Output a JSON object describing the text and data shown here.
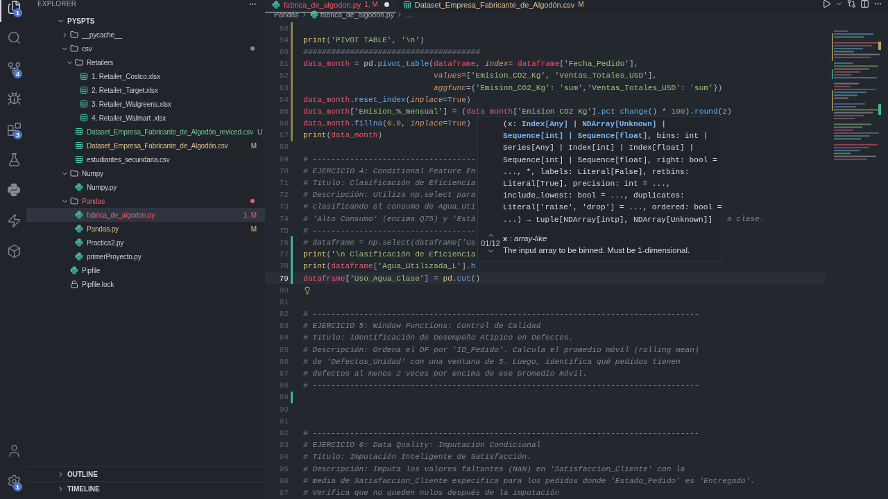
{
  "activity_bar": {
    "items": [
      {
        "kind": "files",
        "badge": "1",
        "selected": true
      },
      {
        "kind": "search",
        "selected": false
      },
      {
        "kind": "source-control",
        "badge": "4",
        "selected": false
      },
      {
        "kind": "debug",
        "selected": false
      },
      {
        "kind": "extensions",
        "badge": "3",
        "selected": false
      },
      {
        "kind": "testing",
        "selected": false
      },
      {
        "kind": "python",
        "selected": false
      },
      {
        "kind": "lightning",
        "selected": false
      },
      {
        "kind": "box",
        "selected": false
      }
    ],
    "bottom": [
      {
        "kind": "account"
      },
      {
        "kind": "settings",
        "badge": "1"
      }
    ]
  },
  "sidebar": {
    "title": "EXPLORER",
    "root": {
      "label": "PYSPTS",
      "expanded": true
    },
    "tree": [
      {
        "name": "__pycache__",
        "kind": "folder",
        "expanded": false,
        "selected": false,
        "dot": false
      },
      {
        "name": "csv",
        "kind": "folder",
        "expanded": true,
        "selected": false,
        "dot": true,
        "children": [
          {
            "name": "Retailers",
            "kind": "folder",
            "expanded": true,
            "selected": false,
            "dot": false,
            "children": [
              {
                "name": "1. Retailer_Costco.xlsx",
                "kind": "sheet",
                "selected": false,
                "dot": false
              },
              {
                "name": "2. Retailer_Target.xlsx",
                "kind": "sheet",
                "selected": false,
                "dot": false
              },
              {
                "name": "3. Retailer_Walgreens.xlsx",
                "kind": "sheet",
                "selected": false,
                "dot": false
              },
              {
                "name": "4. Retailer_Walmart .xlsx",
                "kind": "sheet",
                "selected": false,
                "dot": false
              }
            ]
          },
          {
            "name": "Dataset_Empresa_Fabricante_de_Algodón_reviced.csv",
            "kind": "sheet",
            "color": "#73c991",
            "status": "U",
            "selected": false,
            "dot": false
          },
          {
            "name": "Dataset_Empresa_Fabricante_de_Algodón.csv",
            "kind": "sheet",
            "color": "#e2c08d",
            "status": "M",
            "selected": false,
            "dot": false
          },
          {
            "name": "estudiantes_secundaria.csv",
            "kind": "sheet",
            "selected": false,
            "dot": false
          }
        ]
      },
      {
        "name": "Numpy",
        "kind": "folder",
        "expanded": true,
        "selected": false,
        "dot": false,
        "children": [
          {
            "name": "Numpy.py",
            "kind": "python",
            "selected": false,
            "dot": false
          }
        ]
      },
      {
        "name": "Pandas",
        "kind": "folder",
        "expanded": true,
        "color": "#e8606a",
        "selected": false,
        "dot": true,
        "children": [
          {
            "name": "fabrica_de_algodon.py",
            "kind": "python",
            "color": "#e8606a",
            "status": "1, M",
            "selected": true,
            "dot": false
          },
          {
            "name": "Pandas.py",
            "kind": "python",
            "color": "#e2c08d",
            "status": "M",
            "selected": false,
            "dot": false
          },
          {
            "name": "Practica2.py",
            "kind": "python",
            "selected": false,
            "dot": false
          },
          {
            "name": "primerProyecto.py",
            "kind": "python",
            "selected": false,
            "dot": false
          }
        ]
      },
      {
        "name": "Pipfile",
        "kind": "python",
        "selected": false,
        "dot": false
      },
      {
        "name": "Pipfile.lock",
        "kind": "lock",
        "selected": false,
        "dot": false
      }
    ],
    "sections": [
      {
        "label": "OUTLINE",
        "expanded": false
      },
      {
        "label": "TIMELINE",
        "expanded": false
      }
    ]
  },
  "editor": {
    "tabs": [
      {
        "label": "fabrica_de_algodon.py",
        "kind": "python",
        "status": "1, M",
        "color": "#e8606a",
        "selected": true,
        "dirty": true
      },
      {
        "label": "Dataset_Empresa_Fabricante_de_Algodón.csv",
        "kind": "sheet",
        "status": "M",
        "color": "#e2c08d",
        "selected": false,
        "dirty": false
      }
    ],
    "breadcrumb": [
      {
        "label": "Pandas"
      },
      {
        "label": "fabrica_de_algodon.py",
        "kind": "python"
      },
      {
        "label": "…"
      }
    ],
    "lines": [
      {
        "number": "58",
        "current": false,
        "modified": true
      },
      {
        "number": "59",
        "current": false,
        "modified": true,
        "tokens": [
          {
            "kind": "fn",
            "text": "print"
          },
          {
            "kind": "punct",
            "text": "("
          },
          {
            "kind": "str",
            "text": "'PIVOT TABLE'"
          },
          {
            "kind": "punct",
            "text": ", "
          },
          {
            "kind": "str",
            "text": "'\\n'"
          },
          {
            "kind": "punct",
            "text": ")"
          }
        ]
      },
      {
        "number": "60",
        "current": false,
        "modified": true,
        "tokens": [
          {
            "kind": "comment",
            "text": "######################################"
          }
        ]
      },
      {
        "number": "61",
        "current": false,
        "modified": true,
        "tokens": [
          {
            "kind": "var",
            "text": "data_month"
          },
          {
            "kind": "punct",
            "text": " = "
          },
          {
            "kind": "mod",
            "text": "pd"
          },
          {
            "kind": "punct",
            "text": "."
          },
          {
            "kind": "method",
            "text": "pivot_table"
          },
          {
            "kind": "punct",
            "text": "("
          },
          {
            "kind": "var",
            "text": "dataframe"
          },
          {
            "kind": "punct",
            "text": ", "
          },
          {
            "kind": "param",
            "text": "index"
          },
          {
            "kind": "punct",
            "text": "= "
          },
          {
            "kind": "var",
            "text": "dataframe"
          },
          {
            "kind": "punct",
            "text": "["
          },
          {
            "kind": "str",
            "text": "'Fecha_Pedido'"
          },
          {
            "kind": "punct",
            "text": "],"
          }
        ]
      },
      {
        "number": "62",
        "current": false,
        "modified": true,
        "tokens": [
          {
            "kind": "param",
            "text": "                            values"
          },
          {
            "kind": "punct",
            "text": "=["
          },
          {
            "kind": "str",
            "text": "'Emision_CO2_Kg'"
          },
          {
            "kind": "punct",
            "text": ", "
          },
          {
            "kind": "str",
            "text": "'Ventas_Totales_USD'"
          },
          {
            "kind": "punct",
            "text": "],"
          }
        ]
      },
      {
        "number": "63",
        "current": false,
        "modified": true,
        "tokens": [
          {
            "kind": "param",
            "text": "                            aggfunc"
          },
          {
            "kind": "punct",
            "text": "={"
          },
          {
            "kind": "str",
            "text": "'Emision_CO2_Kg'"
          },
          {
            "kind": "punct",
            "text": ": "
          },
          {
            "kind": "str",
            "text": "'sum'"
          },
          {
            "kind": "punct",
            "text": ","
          },
          {
            "kind": "str",
            "text": "'Ventas_Totales_USD'"
          },
          {
            "kind": "punct",
            "text": ": "
          },
          {
            "kind": "str",
            "text": "'sum'"
          },
          {
            "kind": "punct",
            "text": "})"
          }
        ]
      },
      {
        "number": "64",
        "current": false,
        "modified": true,
        "tokens": [
          {
            "kind": "var",
            "text": "data_month"
          },
          {
            "kind": "punct",
            "text": "."
          },
          {
            "kind": "method",
            "text": "reset_index"
          },
          {
            "kind": "punct",
            "text": "("
          },
          {
            "kind": "param",
            "text": "inplace"
          },
          {
            "kind": "punct",
            "text": "="
          },
          {
            "kind": "const",
            "text": "True"
          },
          {
            "kind": "punct",
            "text": ")"
          }
        ]
      },
      {
        "number": "65",
        "current": false,
        "modified": true,
        "tokens": [
          {
            "kind": "var",
            "text": "data_month"
          },
          {
            "kind": "punct",
            "text": "["
          },
          {
            "kind": "str",
            "text": "'Emision_%_mensual'"
          },
          {
            "kind": "punct",
            "text": "] = ("
          },
          {
            "kind": "var",
            "text": "data month"
          },
          {
            "kind": "punct",
            "text": "["
          },
          {
            "kind": "str",
            "text": "'Emision CO2 Kg'"
          },
          {
            "kind": "punct",
            "text": "]."
          },
          {
            "kind": "method",
            "text": "pct change"
          },
          {
            "kind": "punct",
            "text": "() * "
          },
          {
            "kind": "num",
            "text": "100"
          },
          {
            "kind": "punct",
            "text": ")."
          },
          {
            "kind": "method",
            "text": "round"
          },
          {
            "kind": "punct",
            "text": "("
          },
          {
            "kind": "num",
            "text": "2"
          },
          {
            "kind": "punct",
            "text": ")"
          }
        ]
      },
      {
        "number": "66",
        "current": false,
        "modified": true,
        "tokens": [
          {
            "kind": "var",
            "text": "data_month"
          },
          {
            "kind": "punct",
            "text": "."
          },
          {
            "kind": "method",
            "text": "fillna"
          },
          {
            "kind": "punct",
            "text": "("
          },
          {
            "kind": "num",
            "text": "0.0"
          },
          {
            "kind": "punct",
            "text": ", "
          },
          {
            "kind": "param",
            "text": "inplace"
          },
          {
            "kind": "punct",
            "text": "="
          },
          {
            "kind": "const",
            "text": "True"
          },
          {
            "kind": "punct",
            "text": ")"
          }
        ]
      },
      {
        "number": "67",
        "current": false,
        "modified": true,
        "tokens": [
          {
            "kind": "fn",
            "text": "print"
          },
          {
            "kind": "punct",
            "text": "("
          },
          {
            "kind": "var",
            "text": "data_month"
          },
          {
            "kind": "punct",
            "text": ")"
          }
        ]
      },
      {
        "number": "68",
        "current": false
      },
      {
        "number": "69",
        "current": false,
        "tokens": [
          {
            "kind": "comment",
            "text": "# -----------------------------------"
          }
        ]
      },
      {
        "number": "70",
        "current": false,
        "tokens": [
          {
            "kind": "comment",
            "text": "# EJERCICIO 4: Conditional Feature En"
          }
        ]
      },
      {
        "number": "71",
        "current": false,
        "tokens": [
          {
            "kind": "comment",
            "text": "# Título: Clasificación de Eficiencia"
          }
        ]
      },
      {
        "number": "72",
        "current": false,
        "tokens": [
          {
            "kind": "comment",
            "text": "# Descripción: Utiliza np.select para"
          }
        ]
      },
      {
        "number": "73",
        "current": false,
        "tokens": [
          {
            "kind": "comment",
            "text": "# clasificando el consumo de Agua_Uti"
          }
        ]
      },
      {
        "number": "74",
        "current": false,
        "tokens": [
          {
            "kind": "comment",
            "text": "# 'Alto Consumo' (encima Q75) y 'Está"
          },
          {
            "kind": "tail",
            "text": "a clase."
          }
        ]
      },
      {
        "number": "75",
        "current": false,
        "tokens": [
          {
            "kind": "comment",
            "text": "# -----------------------------------"
          }
        ]
      },
      {
        "number": "76",
        "current": false,
        "added": true,
        "tokens": [
          {
            "kind": "comment",
            "text": "# dataframe = np.select(dataframe['Us"
          }
        ]
      },
      {
        "number": "77",
        "current": false,
        "added": true,
        "tokens": [
          {
            "kind": "fn",
            "text": "print"
          },
          {
            "kind": "punct",
            "text": "("
          },
          {
            "kind": "str",
            "text": "'\\n Clasificación de Eficiencia"
          }
        ]
      },
      {
        "number": "78",
        "current": false,
        "added": true,
        "tokens": [
          {
            "kind": "fn",
            "text": "print"
          },
          {
            "kind": "punct",
            "text": "("
          },
          {
            "kind": "var",
            "text": "dataframe"
          },
          {
            "kind": "punct",
            "text": "["
          },
          {
            "kind": "str",
            "text": "'Agua_Utilizada_L'"
          },
          {
            "kind": "punct",
            "text": "]."
          },
          {
            "kind": "method",
            "text": "h"
          }
        ]
      },
      {
        "number": "79",
        "current": true,
        "added": true,
        "tokens": [
          {
            "kind": "var",
            "text": "dataframe"
          },
          {
            "kind": "punct",
            "text": "["
          },
          {
            "kind": "str",
            "text": "'Uso_Agua_Clase'"
          },
          {
            "kind": "punct",
            "text": "] = "
          },
          {
            "kind": "mod",
            "text": "pd"
          },
          {
            "kind": "punct",
            "text": "."
          },
          {
            "kind": "method",
            "text": "cut"
          },
          {
            "kind": "punct",
            "text": "()"
          }
        ]
      },
      {
        "number": "80",
        "current": false,
        "lightbulb": true
      },
      {
        "number": "81",
        "current": false
      },
      {
        "number": "82",
        "current": false,
        "tokens": [
          {
            "kind": "comment",
            "text": "# -----------------------------------------------------------------------------------"
          }
        ]
      },
      {
        "number": "83",
        "current": false,
        "tokens": [
          {
            "kind": "comment",
            "text": "# EJERCICIO 5: Window Functions: Control de Calidad"
          }
        ]
      },
      {
        "number": "84",
        "current": false,
        "tokens": [
          {
            "kind": "comment",
            "text": "# Título: Identificación de Desempeño Atípico en Defectos."
          }
        ]
      },
      {
        "number": "85",
        "current": false,
        "tokens": [
          {
            "kind": "comment",
            "text": "# Descripción: Ordena el DF por 'ID_Pedido'. Calcula el promedio móvil (rolling mean)"
          }
        ]
      },
      {
        "number": "86",
        "current": false,
        "tokens": [
          {
            "kind": "comment",
            "text": "# de 'Defectos_Unidad' con una ventana de 5. Luego, identifica qué pedidos tienen"
          }
        ]
      },
      {
        "number": "87",
        "current": false,
        "tokens": [
          {
            "kind": "comment",
            "text": "# defectos al menos 2 veces por encima de ese promedio móvil."
          }
        ]
      },
      {
        "number": "88",
        "current": false,
        "tokens": [
          {
            "kind": "comment",
            "text": "# -----------------------------------------------------------------------------------"
          }
        ]
      },
      {
        "number": "89",
        "current": false,
        "added": true
      },
      {
        "number": "90",
        "current": false
      },
      {
        "number": "91",
        "current": false
      },
      {
        "number": "92",
        "current": false,
        "tokens": [
          {
            "kind": "comment",
            "text": "# -----------------------------------------------------------------------------------"
          }
        ]
      },
      {
        "number": "93",
        "current": false,
        "tokens": [
          {
            "kind": "comment",
            "text": "# EJERCICIO 6: Data Quality: Imputación Condicional"
          }
        ]
      },
      {
        "number": "94",
        "current": false,
        "tokens": [
          {
            "kind": "comment",
            "text": "# Título: Imputación Inteligente de Satisfacción."
          }
        ]
      },
      {
        "number": "95",
        "current": false,
        "tokens": [
          {
            "kind": "comment",
            "text": "# Descripción: Imputa los valores faltantes (NaN) en 'Satisfaccion_Cliente' con la"
          }
        ]
      },
      {
        "number": "96",
        "current": false,
        "tokens": [
          {
            "kind": "comment",
            "text": "# media de Satisfaccion_Cliente específica para los pedidos donde 'Estado_Pedido' es 'Entregado'."
          }
        ]
      },
      {
        "number": "97",
        "current": false,
        "tokens": [
          {
            "kind": "comment",
            "text": "# Verifica que no queden nulos después de la imputación"
          }
        ]
      }
    ],
    "hover": {
      "counter": "01/12",
      "signature": [
        {
          "kind": "plain",
          "text": "("
        },
        {
          "kind": "active",
          "text": "x: Index[Any] | NDArray[Unknown] | Sequence[int] | Sequence[float]"
        },
        {
          "kind": "plain",
          "text": ", bins: int | Series[Any] | Index[int] | Index[float] | Sequence[int] | Sequence[float], right: bool = ..., *, labels: Literal[False], retbins: Literal[True], precision: int = ..., include_lowest: bool = ..., duplicates: Literal['raise', 'drop'] = ..., ordered: bool = ...) → tuple[NDArray[intp], NDArray[Unknown]]"
        }
      ],
      "param": "**x** : *array-like*",
      "doc": "The input array to be binned. Must be 1-dimensional."
    }
  }
}
